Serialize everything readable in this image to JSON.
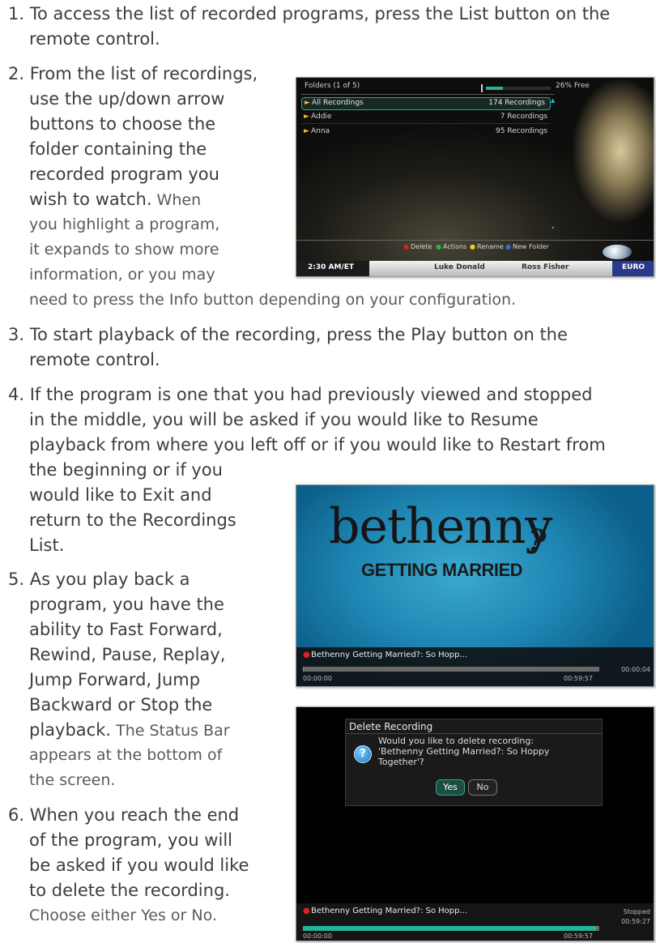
{
  "steps": {
    "s1": [
      "1. To access the list of recorded programs, press the List button on the",
      "remote control."
    ],
    "s2": [
      "2. From the list of recordings,",
      "use the up/down arrow",
      "buttons to choose the",
      "folder containing the",
      "recorded program you",
      "wish to watch.",
      " When",
      "you highlight a program,",
      "it expands to show more",
      "information, or you may",
      "need to press the Info button depending on your configuration."
    ],
    "s3": [
      "3. To start playback of the recording, press the Play button on the",
      "remote control."
    ],
    "s4": [
      "4. If the program is one that you had previously viewed and stopped",
      "in the middle, you will be asked if you would like to Resume",
      "playback from where you left off or if you would like to Restart from",
      "the beginning or if you",
      "would like to Exit and",
      "return to the Recordings",
      "List."
    ],
    "s5": [
      "5. As you play back a",
      "program, you have the",
      "ability to Fast Forward,",
      "Rewind, Pause, Replay,",
      "Jump Forward, Jump",
      "Backward or Stop the",
      "playback.",
      " The Status Bar",
      "appears at the bottom of",
      "the screen."
    ],
    "s6": [
      "6. When you reach the end",
      "of the program, you will",
      "be asked if you would like",
      "to delete the recording.",
      "Choose either Yes or No."
    ]
  },
  "shot1": {
    "header": "Folders (1 of 5)",
    "free": "26% Free",
    "free_fraction": 0.26,
    "folders": [
      {
        "name": "All Recordings",
        "count": "174 Recordings"
      },
      {
        "name": "Addie",
        "count": "7 Recordings"
      },
      {
        "name": "Anna",
        "count": "95 Recordings"
      }
    ],
    "actions": [
      "Delete",
      "Actions",
      "Rename",
      "New Folder"
    ],
    "action_colors": [
      "#e02020",
      "#2fb24a",
      "#f0d020",
      "#2f6fe0"
    ],
    "ticker": [
      "2:30 AM/ET",
      "Luke Donald",
      "Ross Fisher",
      "EURO"
    ]
  },
  "shot2": {
    "logo_main": "bethenny",
    "logo_sub": "GETTING MARRIED",
    "logo_mark": "?",
    "title": "Bethenny Getting Married?: So Hopp...",
    "elapsed": "00:00:04",
    "start": "00:00:00",
    "end": "00:59:57",
    "progress": 0.001
  },
  "shot3": {
    "dialog_title": "Delete Recording",
    "message": [
      "Would you like to delete recording:",
      "'Bethenny Getting Married?: So Hoppy",
      "Together'?"
    ],
    "yes": "Yes",
    "no": "No",
    "title": "Bethenny Getting Married?: So Hopp...",
    "state": "Stopped",
    "elapsed": "00:59:27",
    "start": "00:00:00",
    "end": "00:59:57",
    "progress": 0.99
  }
}
